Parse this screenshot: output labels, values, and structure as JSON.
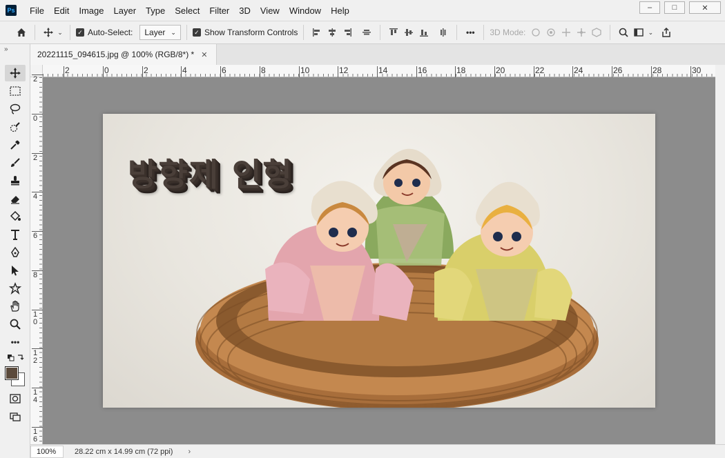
{
  "app": {
    "logo": "Ps"
  },
  "menu": [
    "File",
    "Edit",
    "Image",
    "Layer",
    "Type",
    "Select",
    "Filter",
    "3D",
    "View",
    "Window",
    "Help"
  ],
  "window_controls": {
    "minimize": "–",
    "maximize": "□",
    "close": "✕"
  },
  "options": {
    "auto_select_label": "Auto-Select:",
    "auto_select_target": "Layer",
    "show_transform_label": "Show Transform Controls",
    "more": "•••",
    "mode_3d_label": "3D Mode:"
  },
  "document": {
    "tab_title": "20221115_094615.jpg @ 100% (RGB/8*) *",
    "close": "✕",
    "overlay_text": "방향제 인형"
  },
  "rulers": {
    "horizontal": [
      "2",
      "0",
      "2",
      "4",
      "6",
      "8",
      "10",
      "12",
      "14",
      "16",
      "18",
      "20",
      "22",
      "24",
      "26",
      "28",
      "30"
    ],
    "vertical": [
      "2",
      "0",
      "2",
      "4",
      "6",
      "8",
      "10",
      "12",
      "14",
      "16"
    ]
  },
  "status": {
    "zoom": "100%",
    "size": "28.22 cm x 14.99 cm (72 ppi)",
    "arrow": "›"
  },
  "colors": {
    "foreground": "#5b4a3c",
    "background": "#ffffff",
    "workspace": "#8c8c8c"
  }
}
